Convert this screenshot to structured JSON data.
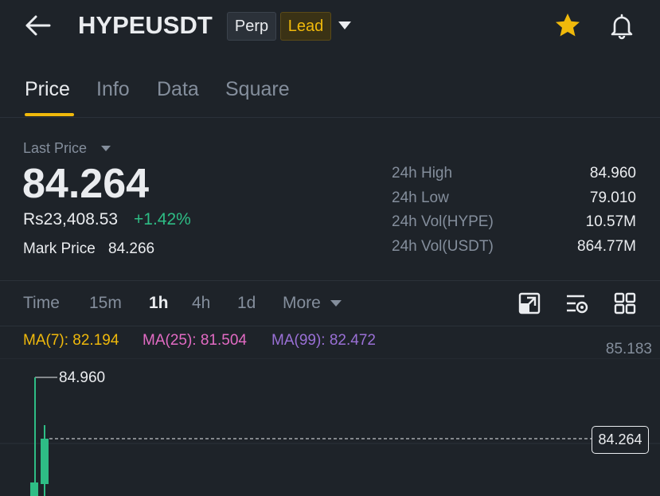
{
  "header": {
    "symbol": "HYPEUSDT",
    "badges": {
      "perp": "Perp",
      "lead": "Lead"
    },
    "icons": {
      "back": "arrow-left-icon",
      "dropdown": "caret-down-icon",
      "favorite": "star-icon",
      "alerts": "bell-icon"
    }
  },
  "tabs": [
    {
      "label": "Price",
      "active": true
    },
    {
      "label": "Info",
      "active": false
    },
    {
      "label": "Data",
      "active": false
    },
    {
      "label": "Square",
      "active": false
    }
  ],
  "price": {
    "last_label": "Last Price",
    "last": "84.264",
    "fiat": "Rs23,408.53",
    "change": "+1.42%",
    "mark_label": "Mark Price",
    "mark": "84.266"
  },
  "stats": [
    {
      "label": "24h High",
      "value": "84.960"
    },
    {
      "label": "24h Low",
      "value": "79.010"
    },
    {
      "label": "24h Vol(HYPE)",
      "value": "10.57M"
    },
    {
      "label": "24h Vol(USDT)",
      "value": "864.77M"
    }
  ],
  "timeframes": {
    "items": [
      "Time",
      "15m",
      "1h",
      "4h",
      "1d"
    ],
    "active": "1h",
    "more": "More"
  },
  "chart_tools": {
    "icons": [
      "fullscreen-icon",
      "indicator-settings-icon",
      "grid-layout-icon"
    ]
  },
  "ma": {
    "ma7": "MA(7): 82.194",
    "ma25": "MA(25): 81.504",
    "ma99": "MA(99): 82.472"
  },
  "chart": {
    "axis_top": "85.183",
    "high_marker": "84.960",
    "current_price_tag": "84.264",
    "colors": {
      "up": "#2ebd85",
      "down": "#f6465d",
      "accent": "#f0b90b"
    }
  }
}
